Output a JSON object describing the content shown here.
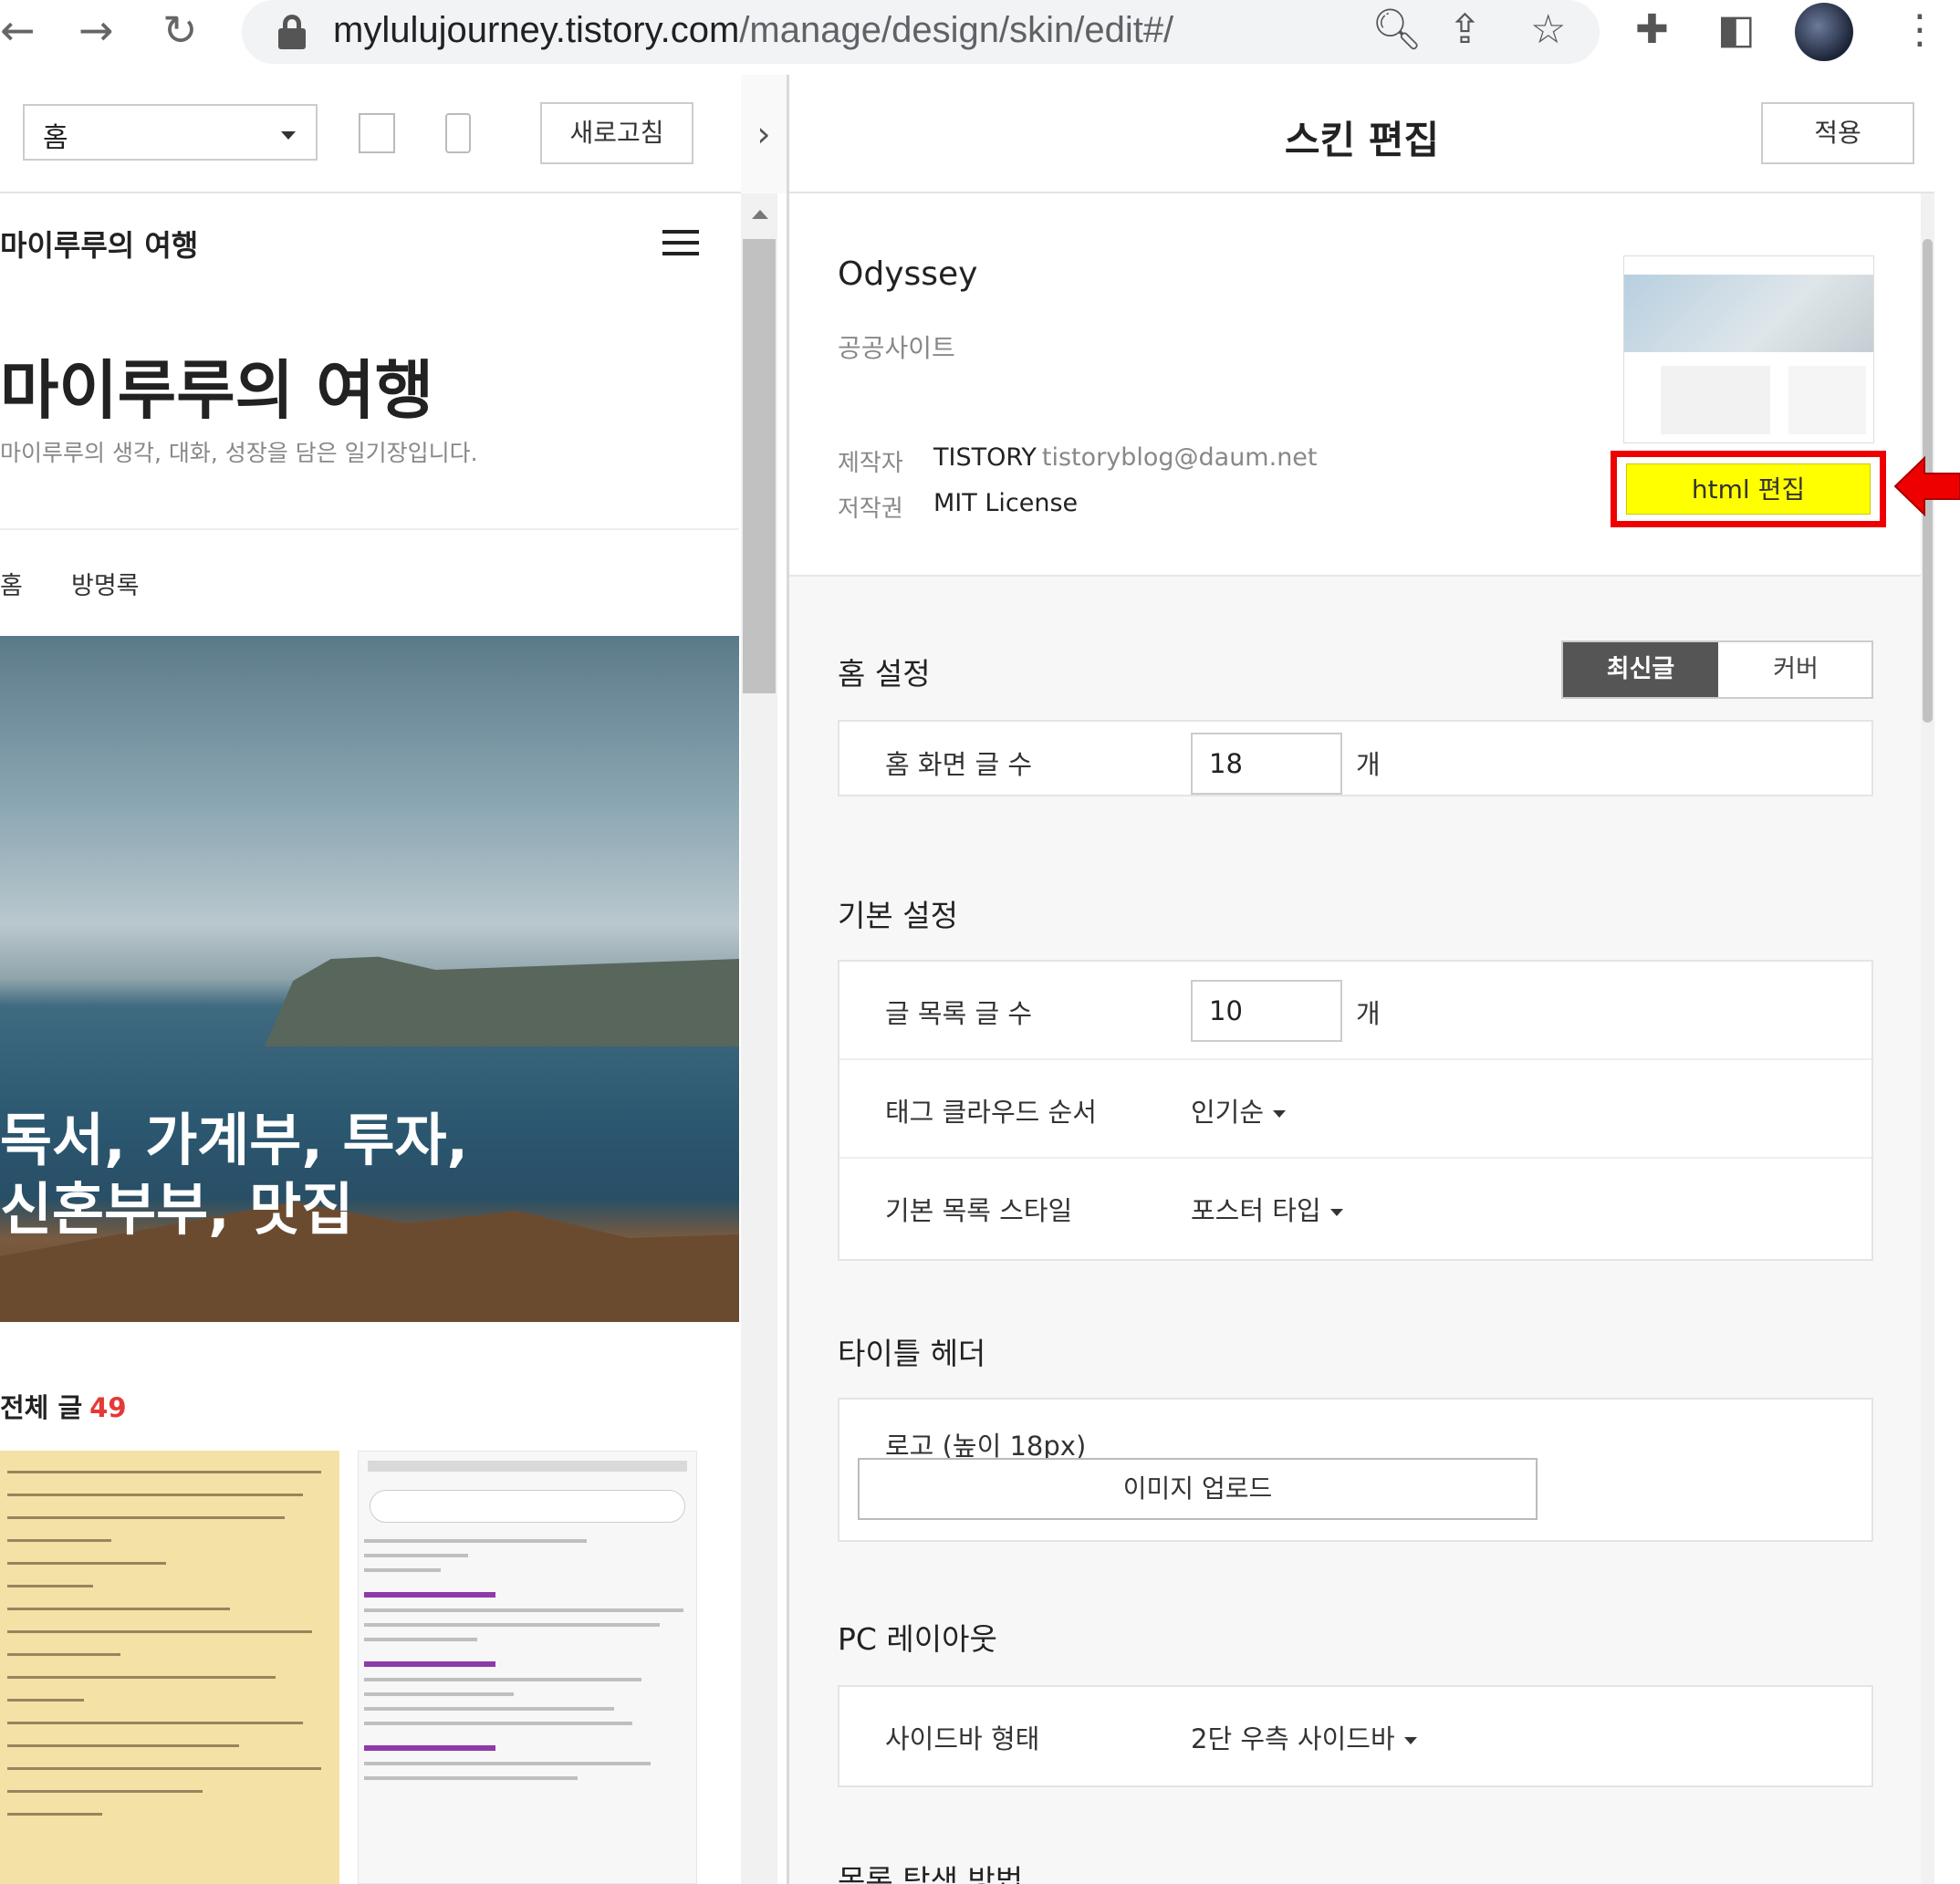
{
  "browser": {
    "url_domain": "mylulujourney.tistory.com",
    "url_path": "/manage/design/skin/edit#/"
  },
  "left_toolbar": {
    "page_select": "홈",
    "refresh_label": "새로고침"
  },
  "preview": {
    "blog_name": "마이루루의 여행",
    "blog_title": "마이루루의 여행",
    "blog_description": "마이루루의 생각, 대화, 성장을 담은 일기장입니다.",
    "menu": [
      "홈",
      "방명록"
    ],
    "hero_line1": "독서, 가계부, 투자,",
    "hero_line2": "신혼부부, 맛집",
    "all_posts_label": "전체 글",
    "all_posts_count": "49"
  },
  "right_header": {
    "title": "스킨 편집",
    "apply_label": "적용"
  },
  "skin_info": {
    "name": "Odyssey",
    "category": "공공사이트",
    "author_label": "제작자",
    "author": "TISTORY",
    "author_email": "tistoryblog@daum.net",
    "license_label": "저작권",
    "license": "MIT License",
    "html_edit_label": "html 편집",
    "highlight_color": "#ffff00",
    "annotation_color": "#ee0000"
  },
  "home_settings": {
    "title": "홈 설정",
    "tabs": [
      "최신글",
      "커버"
    ],
    "active_tab": "최신글",
    "rows": [
      {
        "label": "홈 화면 글 수",
        "value": "18",
        "unit": "개"
      }
    ]
  },
  "basic_settings": {
    "title": "기본 설정",
    "post_count": {
      "label": "글 목록 글 수",
      "value": "10",
      "unit": "개"
    },
    "tag_cloud": {
      "label": "태그 클라우드 순서",
      "value": "인기순"
    },
    "list_style": {
      "label": "기본 목록 스타일",
      "value": "포스터 타입"
    }
  },
  "title_header": {
    "title": "타이틀 헤더",
    "logo_label": "로고 (높이 18px)",
    "upload_label": "이미지 업로드"
  },
  "pc_layout": {
    "title": "PC 레이아웃",
    "sidebar": {
      "label": "사이드바 형태",
      "value": "2단 우측 사이드바"
    }
  },
  "next_section": {
    "title": "목록 탐색 방법"
  }
}
